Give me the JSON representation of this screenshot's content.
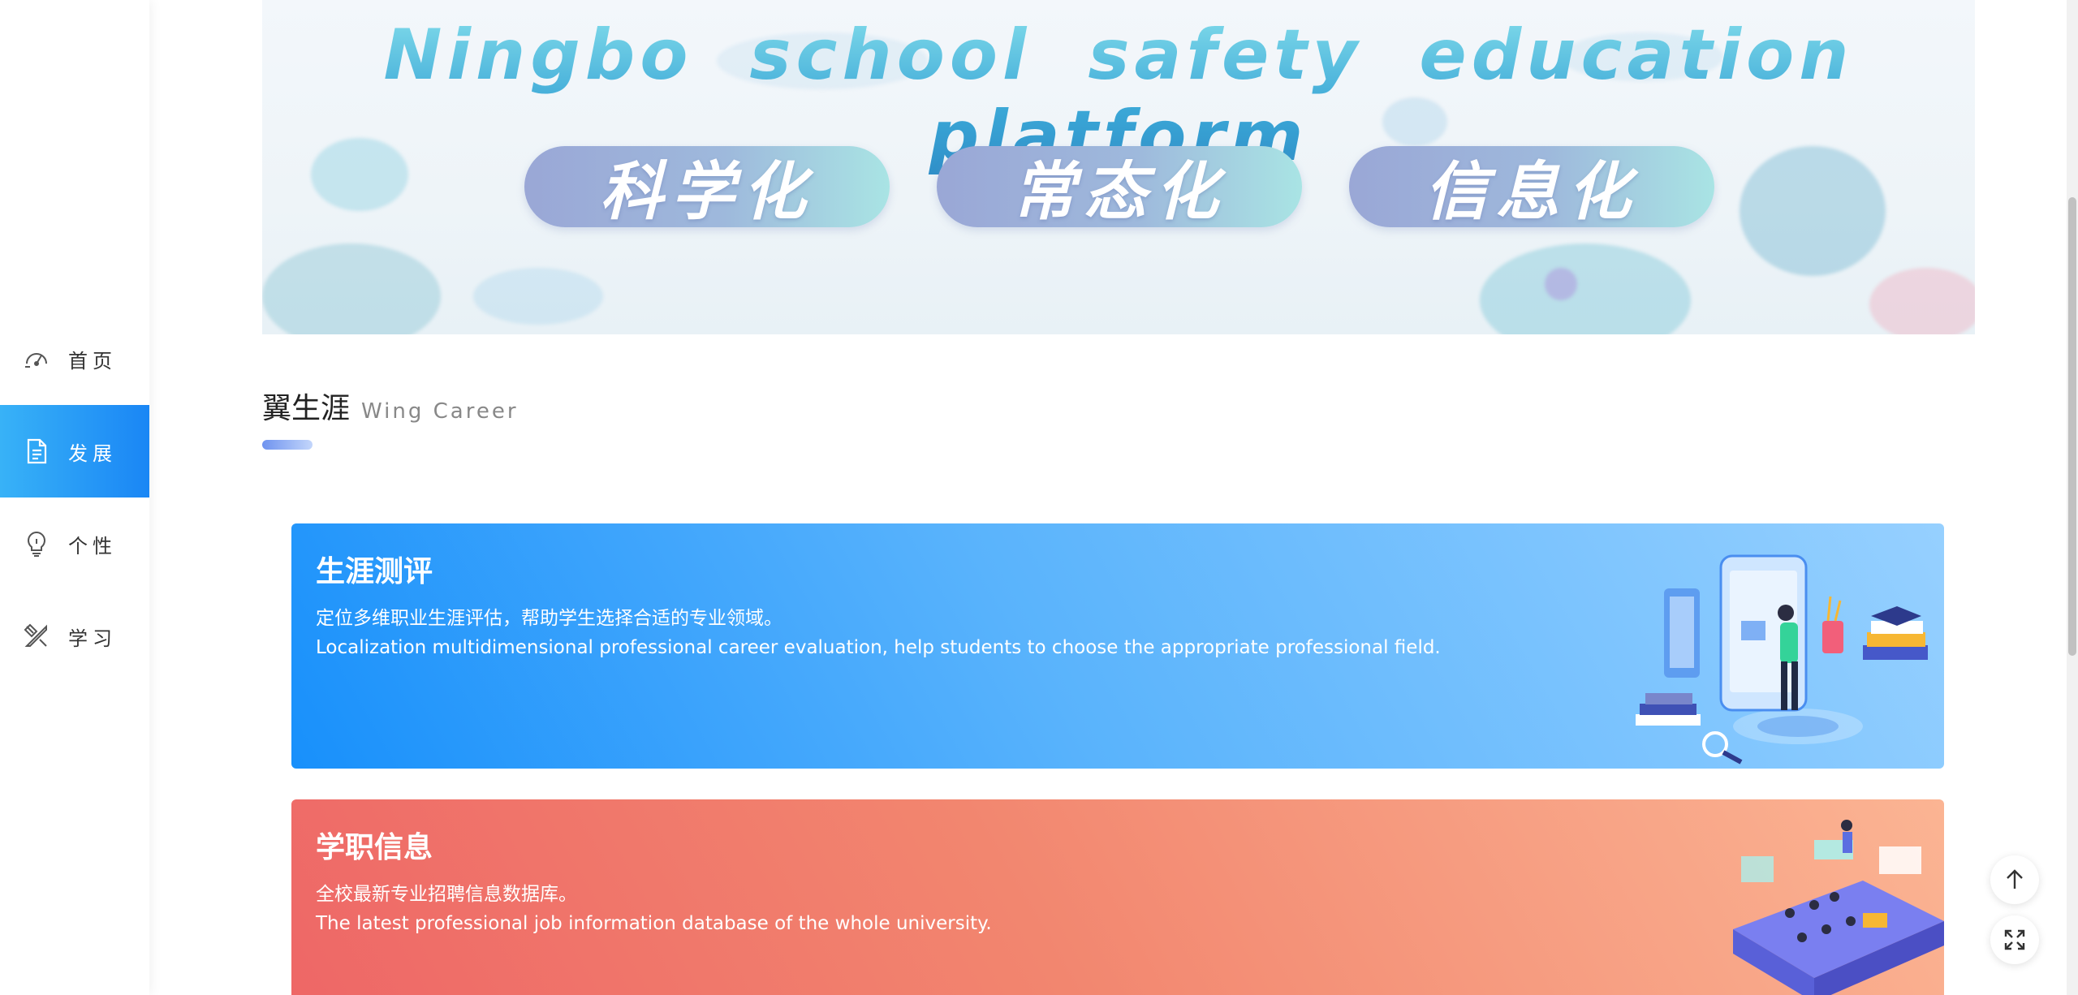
{
  "sidebar": {
    "items": [
      {
        "label": "首页",
        "icon": "dashboard-icon",
        "active": false
      },
      {
        "label": "发展",
        "icon": "document-icon",
        "active": true
      },
      {
        "label": "个性",
        "icon": "lightbulb-icon",
        "active": false
      },
      {
        "label": "学习",
        "icon": "tools-icon",
        "active": false
      }
    ]
  },
  "banner": {
    "title": "Ningbo school safety education platform",
    "pills": [
      "科学化",
      "常态化",
      "信息化"
    ]
  },
  "section": {
    "title": "翼生涯",
    "subtitle": "Wing Career"
  },
  "cards": [
    {
      "title": "生涯测评",
      "desc_cn": "定位多维职业生涯评估，帮助学生选择合适的专业领域。",
      "desc_en": "Localization multidimensional professional career evaluation, help students to choose the appropriate professional field.",
      "color": "#1890fb"
    },
    {
      "title": "学职信息",
      "desc_cn": "全校最新专业招聘信息数据库。",
      "desc_en": "The latest professional job information database of the whole university.",
      "color": "#ee6666"
    }
  ],
  "floating": {
    "top_icon": "arrow-up-icon",
    "fullscreen_icon": "fullscreen-icon"
  }
}
